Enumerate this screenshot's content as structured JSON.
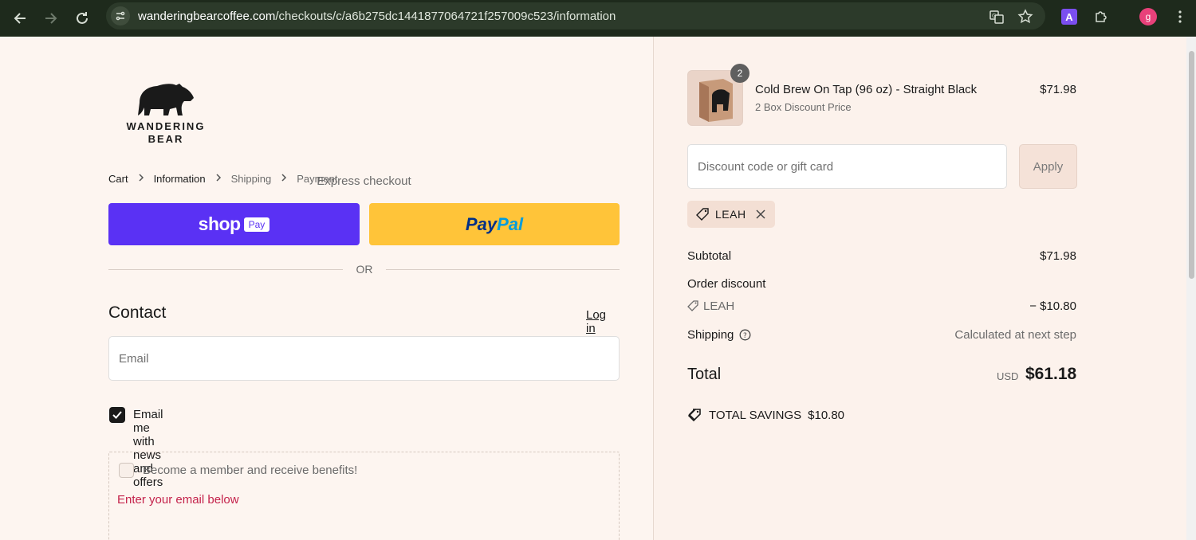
{
  "browser": {
    "url_host": "wanderingbearcoffee.com",
    "url_path": "/checkouts/c/a6b275dc1441877064721f257009c523/information",
    "profile_initial": "g",
    "extension_letter": "A"
  },
  "logo": {
    "line1": "WANDERING",
    "line2": "BEAR"
  },
  "breadcrumbs": [
    {
      "label": "Cart"
    },
    {
      "label": "Information"
    },
    {
      "label": "Shipping"
    },
    {
      "label": "Payment"
    }
  ],
  "express": {
    "title": "Express checkout",
    "shop_pay_word": "shop",
    "shop_pay_badge": "Pay",
    "paypal_part1": "Pay",
    "paypal_part2": "Pal",
    "or_text": "OR"
  },
  "contact": {
    "title": "Contact",
    "login_label": "Log in",
    "email_placeholder": "Email",
    "newsletter_label": "Email me with news and offers",
    "newsletter_checked": true,
    "member_label": "Become a member and receive benefits!",
    "member_hint": "Enter your email below"
  },
  "order": {
    "item": {
      "name": "Cold Brew On Tap (96 oz) - Straight Black",
      "variant": "2 Box Discount Price",
      "price": "$71.98",
      "quantity": "2"
    },
    "discount_placeholder": "Discount code or gift card",
    "apply_label": "Apply",
    "applied_code": "LEAH",
    "subtotal_label": "Subtotal",
    "subtotal_value": "$71.98",
    "order_discount_label": "Order discount",
    "discount_code": "LEAH",
    "discount_value": "− $10.80",
    "shipping_label": "Shipping",
    "shipping_value": "Calculated at next step",
    "total_label": "Total",
    "total_currency": "USD",
    "total_value": "$61.18",
    "savings_label": "TOTAL SAVINGS",
    "savings_value": "$10.80"
  },
  "colors": {
    "shop_pay": "#5a31f4",
    "paypal": "#ffc439",
    "accent_error": "#c4224b"
  }
}
